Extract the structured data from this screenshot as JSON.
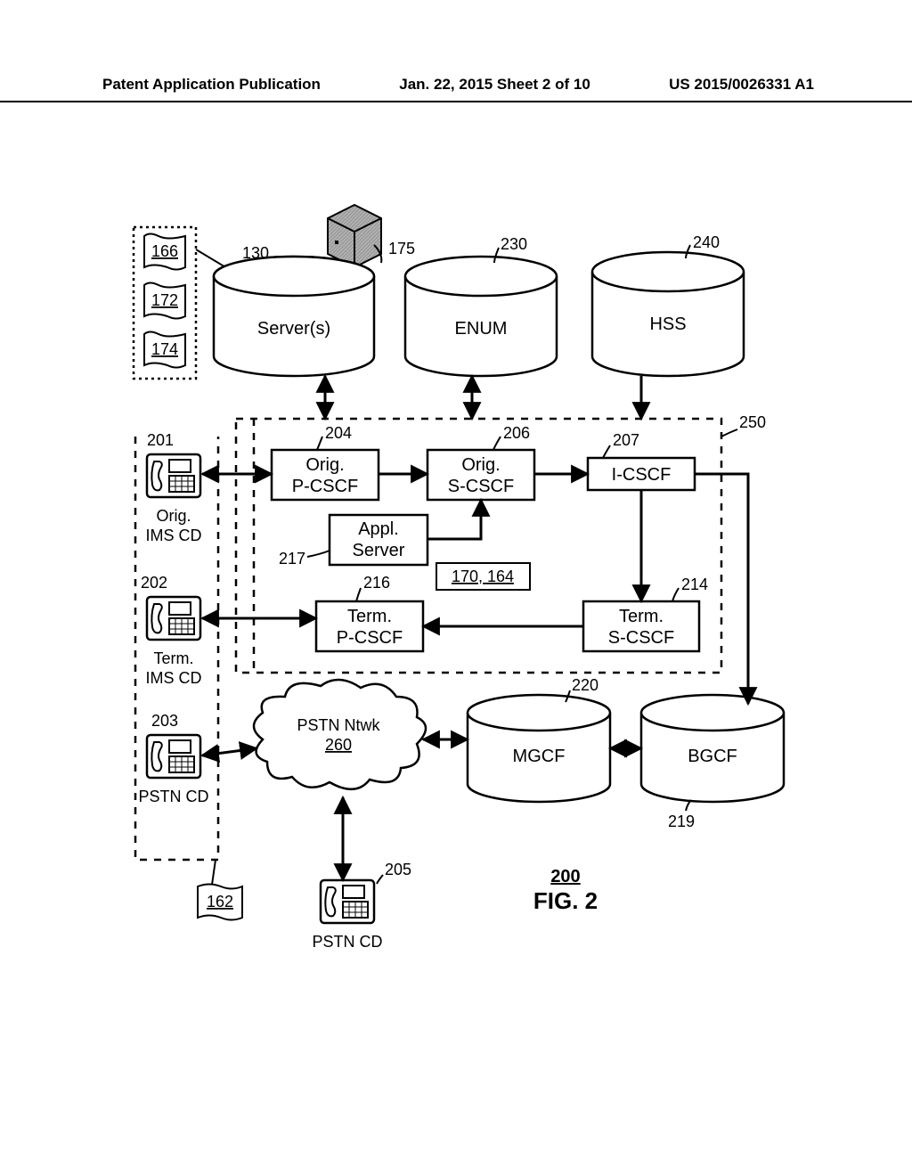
{
  "header": {
    "left": "Patent Application Publication",
    "center": "Jan. 22, 2015  Sheet 2 of 10",
    "right": "US 2015/0026331 A1"
  },
  "refs": {
    "r166": "166",
    "r172": "172",
    "r174": "174",
    "r130": "130",
    "r175": "175",
    "r230": "230",
    "r240": "240",
    "r250": "250",
    "r201": "201",
    "r202": "202",
    "r203": "203",
    "r204": "204",
    "r206": "206",
    "r207": "207",
    "r217": "217",
    "r216": "216",
    "r214": "214",
    "r220": "220",
    "r219": "219",
    "r205": "205",
    "r162": "162",
    "r170_164": "170, 164",
    "r260": "260"
  },
  "labels": {
    "servers": "Server(s)",
    "enum": "ENUM",
    "hss": "HSS",
    "orig_pcscf": "Orig.\nP-CSCF",
    "orig_scscf": "Orig.\nS-CSCF",
    "icscf": "I-CSCF",
    "appl_server": "Appl.\nServer",
    "term_pcscf": "Term.\nP-CSCF",
    "term_scscf": "Term.\nS-CSCF",
    "orig_imscd": "Orig.\nIMS CD",
    "term_imscd": "Term.\nIMS CD",
    "pstn_cd": "PSTN CD",
    "pstn_ntwk": "PSTN Ntwk",
    "mgcf": "MGCF",
    "bgcf": "BGCF",
    "fig": "FIG. 2",
    "fignum": "200"
  }
}
